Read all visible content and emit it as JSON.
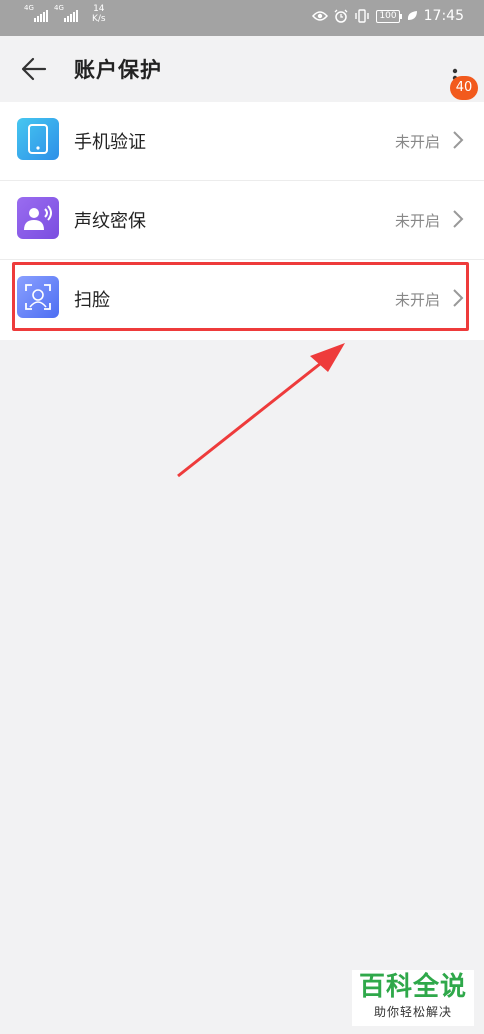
{
  "status_bar": {
    "signal1_tag": "4G",
    "signal2_tag": "4G",
    "net_speed_value": "14",
    "net_speed_unit": "K/s",
    "battery": "100",
    "time": "17:45"
  },
  "header": {
    "title": "账户保护",
    "badge": "40"
  },
  "items": [
    {
      "label": "手机验证",
      "status": "未开启",
      "icon": "phone-icon",
      "color": "#2d8fe8"
    },
    {
      "label": "声纹密保",
      "status": "未开启",
      "icon": "voiceprint-icon",
      "color": "#7a4de0"
    },
    {
      "label": "扫脸",
      "status": "未开启",
      "icon": "face-scan-icon",
      "color": "#4d6ef2"
    }
  ],
  "annotation": {
    "highlight_color": "#ee3b3b"
  },
  "watermark": {
    "title": "百科全说",
    "subtitle": "助你轻松解决"
  }
}
